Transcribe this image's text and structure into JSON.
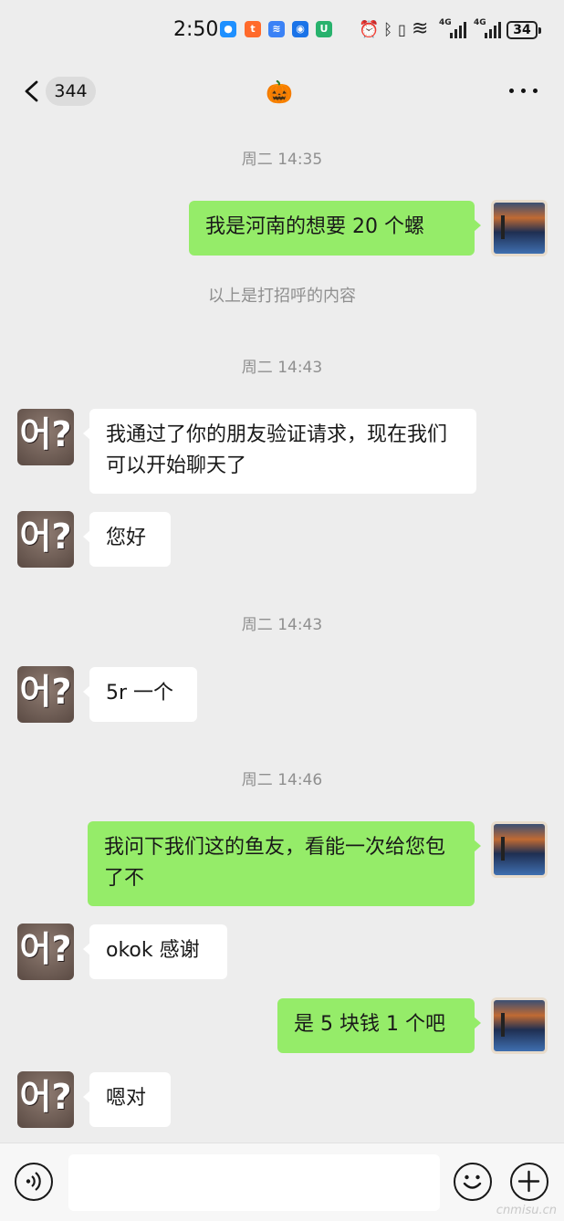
{
  "status_bar": {
    "time": "2:50",
    "network_label_1": "4G",
    "network_label_2": "4G",
    "battery": "34",
    "notification_icons": [
      "message-icon",
      "taobao-icon",
      "voice-app-icon",
      "bot-icon",
      "mi-icon"
    ],
    "system_icons": [
      "alarm-icon",
      "bluetooth-icon",
      "vibrate-icon",
      "wifi-icon",
      "signal-icon",
      "signal-icon",
      "battery-icon"
    ]
  },
  "nav": {
    "unread_count": "344",
    "title_emoji": "🎃"
  },
  "messages": [
    {
      "type": "time",
      "text": "周二 14:35"
    },
    {
      "type": "out",
      "text": "我是河南的想要 20 个螺"
    },
    {
      "type": "system",
      "text": "以上是打招呼的内容"
    },
    {
      "type": "time",
      "text": "周二 14:43"
    },
    {
      "type": "in",
      "text": "我通过了你的朋友验证请求，现在我们可以开始聊天了"
    },
    {
      "type": "in",
      "text": "您好"
    },
    {
      "type": "time",
      "text": "周二 14:43"
    },
    {
      "type": "in",
      "text": "5r 一个"
    },
    {
      "type": "time",
      "text": "周二 14:46"
    },
    {
      "type": "out",
      "text": "我问下我们这的鱼友，看能一次给您包了不"
    },
    {
      "type": "in",
      "text": "okok 感谢"
    },
    {
      "type": "out",
      "text": "是 5 块钱 1 个吧"
    },
    {
      "type": "in",
      "text": "嗯对"
    }
  ],
  "avatar_in_text": "어?",
  "input": {
    "value": "",
    "placeholder": ""
  },
  "icons": {
    "voice": "voice-icon",
    "emoji": "emoji-icon",
    "plus": "plus-icon"
  },
  "colors": {
    "out_bubble": "#95ec69",
    "in_bubble": "#ffffff",
    "background": "#ededed"
  },
  "watermark": "cnmisu.cn"
}
